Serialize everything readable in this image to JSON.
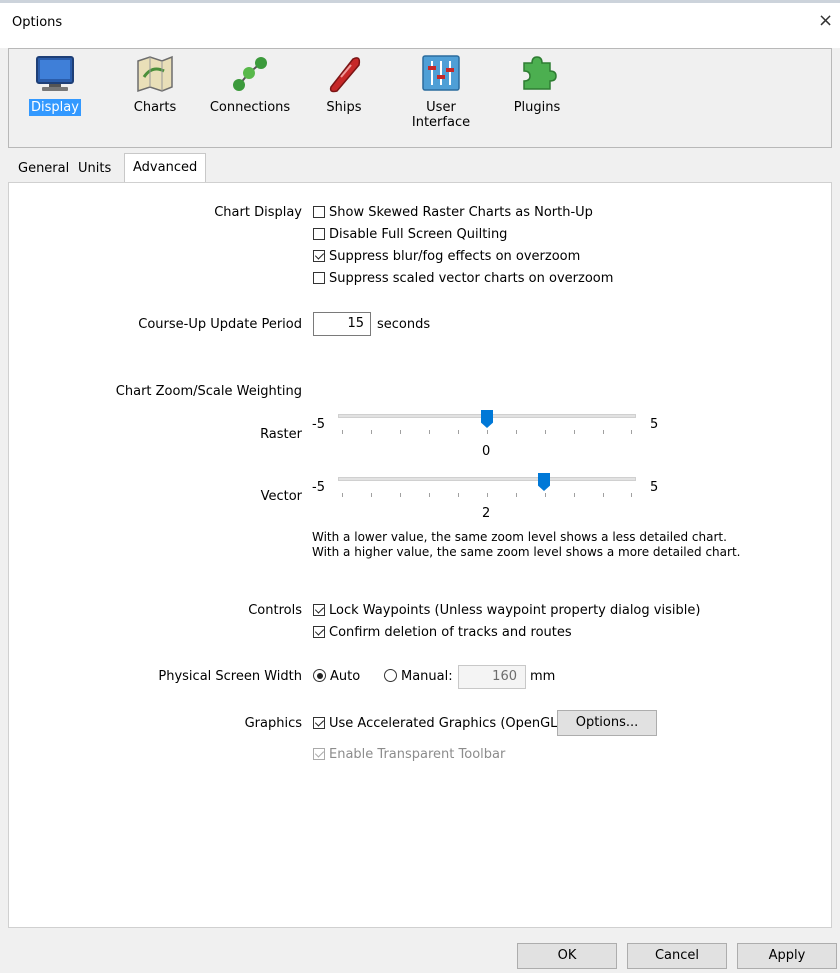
{
  "window": {
    "title": "Options",
    "close_label": "×"
  },
  "toolbar": {
    "items": [
      {
        "label": "Display",
        "icon": "display-icon",
        "selected": true
      },
      {
        "label": "Charts",
        "icon": "charts-icon"
      },
      {
        "label": "Connections",
        "icon": "connections-icon"
      },
      {
        "label": "Ships",
        "icon": "ships-icon"
      },
      {
        "label": "User Interface",
        "icon": "user-interface-icon"
      },
      {
        "label": "Plugins",
        "icon": "plugins-icon"
      }
    ]
  },
  "tabs": [
    {
      "label": "General"
    },
    {
      "label": "Units"
    },
    {
      "label": "Advanced",
      "active": true
    }
  ],
  "chart_display": {
    "label": "Chart Display",
    "options": [
      {
        "label": "Show Skewed Raster Charts as North-Up",
        "checked": false
      },
      {
        "label": "Disable Full Screen Quilting",
        "checked": false
      },
      {
        "label": "Suppress blur/fog effects on overzoom",
        "checked": true
      },
      {
        "label": "Suppress scaled vector charts on overzoom",
        "checked": false
      }
    ]
  },
  "course_up": {
    "label": "Course-Up Update Period",
    "value": "15",
    "unit": "seconds"
  },
  "zoom": {
    "heading": "Chart Zoom/Scale Weighting",
    "raster": {
      "label": "Raster",
      "min": "-5",
      "max": "5",
      "value": "0"
    },
    "vector": {
      "label": "Vector",
      "min": "-5",
      "max": "5",
      "value": "2"
    },
    "help_line1": "With a lower value, the same zoom level shows a less detailed chart.",
    "help_line2": "With a higher value, the same zoom level shows a more detailed chart."
  },
  "controls": {
    "label": "Controls",
    "options": [
      {
        "label": "Lock Waypoints (Unless waypoint property dialog visible)",
        "checked": true
      },
      {
        "label": "Confirm deletion of tracks and routes",
        "checked": true
      }
    ]
  },
  "screen_width": {
    "label": "Physical Screen Width",
    "auto_label": "Auto",
    "manual_label": "Manual:",
    "selected": "Auto",
    "value": "160",
    "unit": "mm"
  },
  "graphics": {
    "label": "Graphics",
    "opengl_label": "Use Accelerated Graphics (OpenGL)",
    "opengl_checked": true,
    "options_button": "Options...",
    "transparent_label": "Enable Transparent Toolbar",
    "transparent_checked": true,
    "transparent_disabled": true
  },
  "footer": {
    "ok": "OK",
    "cancel": "Cancel",
    "apply": "Apply"
  },
  "colors": {
    "accent": "#0078d7",
    "selection": "#3399ff"
  }
}
